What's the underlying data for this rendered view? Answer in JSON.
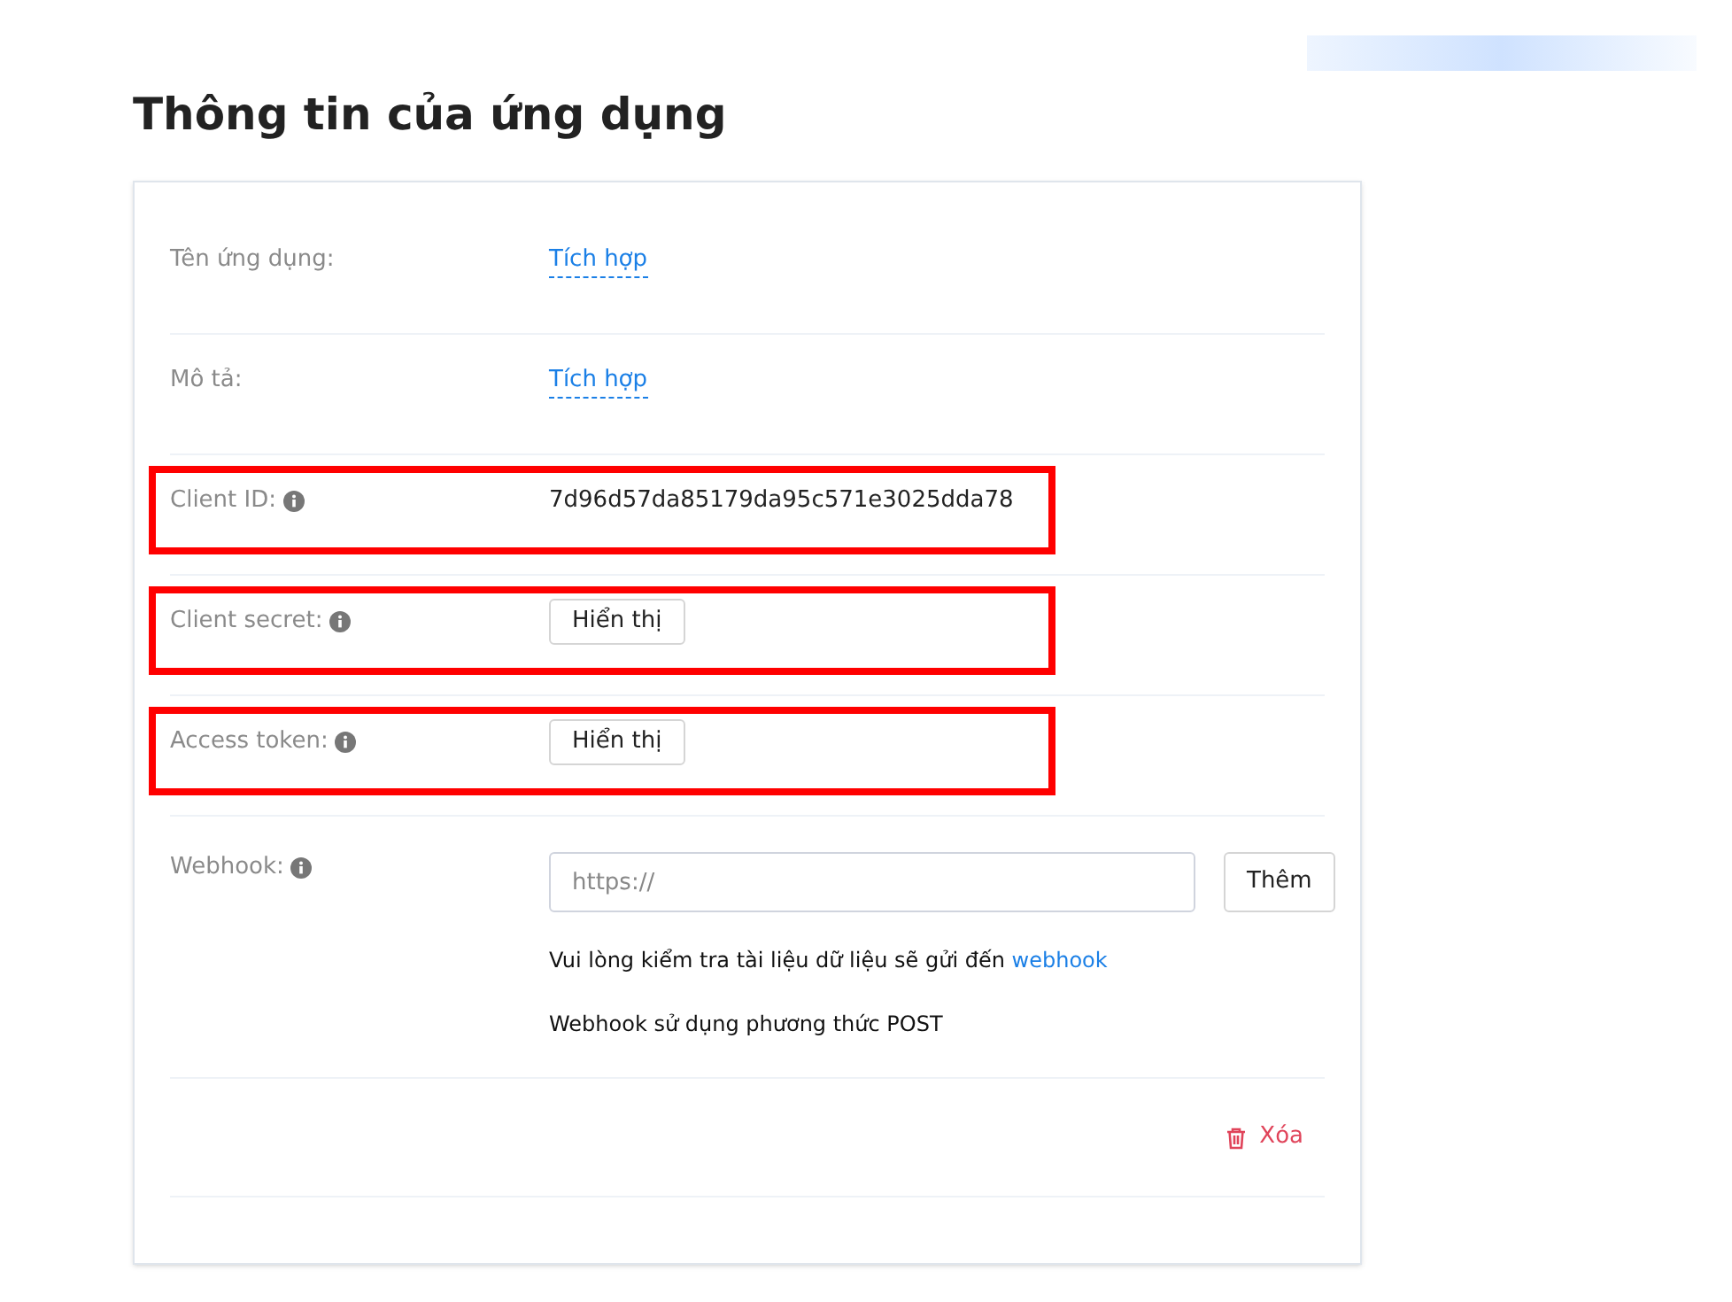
{
  "title": "Thông tin của ứng dụng",
  "rows": [
    {
      "kind": "link",
      "label": "Tên ứng dụng:",
      "info": false,
      "highlighted": false,
      "value": "Tích hợp"
    },
    {
      "kind": "link",
      "label": "Mô tả:",
      "info": false,
      "highlighted": false,
      "value": "Tích hợp"
    },
    {
      "kind": "text",
      "label": "Client ID:",
      "info": true,
      "highlighted": true,
      "value": "7d96d57da85179da95c571e3025dda78"
    },
    {
      "kind": "button",
      "label": "Client secret:",
      "info": true,
      "highlighted": true,
      "value": "Hiển thị"
    },
    {
      "kind": "button",
      "label": "Access token:",
      "info": true,
      "highlighted": true,
      "value": "Hiển thị"
    }
  ],
  "webhook": {
    "label": "Webhook:",
    "info": true,
    "placeholder": "https://",
    "button": "Thêm",
    "note": "Vui lòng kiểm tra tài liệu dữ liệu sẽ gửi đến",
    "note_link": "webhook",
    "method_note": "Webhook sử dụng phương thức POST"
  },
  "delete_button": "Xóa"
}
